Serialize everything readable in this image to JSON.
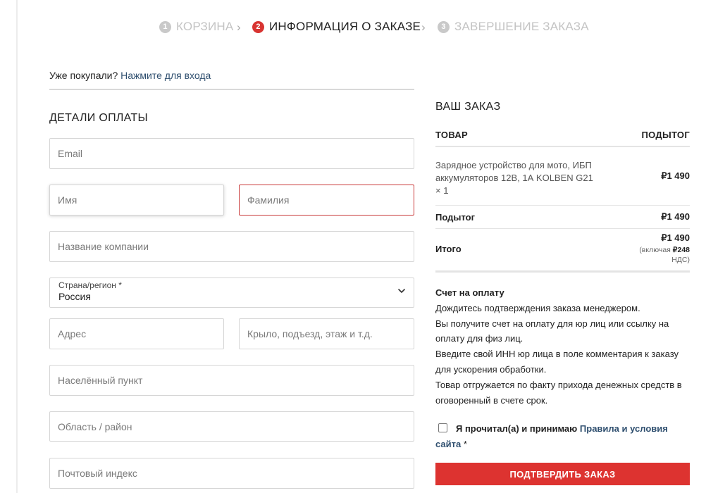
{
  "steps": [
    {
      "num": "1",
      "label": "КОРЗИНА"
    },
    {
      "num": "2",
      "label": "ИНФОРМАЦИЯ О ЗАКАЗЕ"
    },
    {
      "num": "3",
      "label": "ЗАВЕРШЕНИЕ ЗАКАЗА"
    }
  ],
  "step_separator": "›",
  "login": {
    "prompt": "Уже покупали?",
    "link": "Нажмите для входа"
  },
  "billing": {
    "title": "ДЕТАЛИ ОПЛАТЫ",
    "email_placeholder": "Email",
    "first_name_placeholder": "Имя",
    "last_name_placeholder": "Фамилия",
    "company_placeholder": "Название компании",
    "country_label": "Страна/регион *",
    "country_value": "Россия",
    "address_placeholder": "Адрес",
    "address2_placeholder": "Крыло, подъезд, этаж и т.д.",
    "city_placeholder": "Населённый пункт",
    "region_placeholder": "Область / район",
    "postcode_placeholder": "Почтовый индекс"
  },
  "order": {
    "title": "ВАШ ЗАКАЗ",
    "col_product": "ТОВАР",
    "col_subtotal": "ПОДЫТОГ",
    "item_name": "Зарядное устройство для мото, ИБП аккумуляторов 12В, 1А KOLBEN G21",
    "item_qty": "× 1",
    "item_price": "₽1 490",
    "subtotal_label": "Подытог",
    "subtotal_value": "₽1 490",
    "total_label": "Итого",
    "total_value": "₽1 490",
    "tax_prefix": "(включая",
    "tax_amount": "₽248",
    "tax_suffix": "НДС)"
  },
  "payment": {
    "title": "Счет на оплату",
    "lines": [
      "Дождитесь подтверждения заказа менеджером.",
      "Вы получите счет на оплату для юр лиц или ссылку на оплату для физ лиц.",
      "Введите свой ИНН юр лица в поле комментария к заказу для ускорения обработки.",
      "Товар отгружается по факту прихода денежных средств в оговоренный в счете срок."
    ]
  },
  "terms": {
    "text": "Я прочитал(а) и принимаю",
    "link": "Правила и условия сайта",
    "required": "*"
  },
  "confirm_label": "ПОДТВЕРДИТЬ ЗАКАЗ",
  "colors": {
    "accent": "#dd3330",
    "link": "#2f4f6f",
    "error_border": "#c93a3a"
  }
}
